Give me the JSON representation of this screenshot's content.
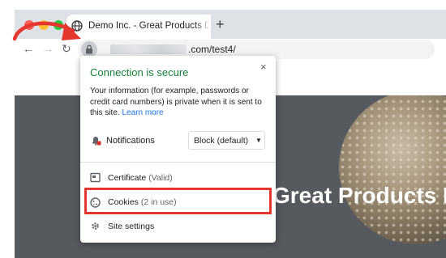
{
  "browser": {
    "tab": {
      "title": "Demo Inc. - Great Products De",
      "favicon": "globe-icon"
    },
    "new_tab_label": "+",
    "nav": {
      "back": "←",
      "forward": "→",
      "reload": "↻"
    },
    "address": {
      "url_visible": ".com/test4/",
      "lock_icon": "lock-icon"
    }
  },
  "page": {
    "hero_title": "Great Products D"
  },
  "site_info_popup": {
    "close": "×",
    "title": "Connection is secure",
    "body": "Your information (for example, passwords or credit card numbers) is private when it is sent to this site.",
    "learn_more": "Learn more",
    "notifications": {
      "label": "Notifications",
      "value": "Block (default)",
      "caret": "▼"
    },
    "rows": [
      {
        "icon": "certificate-icon",
        "label": "Certificate",
        "sub": "(Valid)"
      },
      {
        "icon": "cookie-icon",
        "label": "Cookies",
        "sub": "(2 in use)"
      },
      {
        "icon": "gear-icon",
        "label": "Site settings",
        "sub": ""
      }
    ]
  },
  "colors": {
    "secure_green": "#188038",
    "link_blue": "#1a73e8",
    "annotation_red": "#e4352e",
    "hero_bg": "#56595e"
  }
}
